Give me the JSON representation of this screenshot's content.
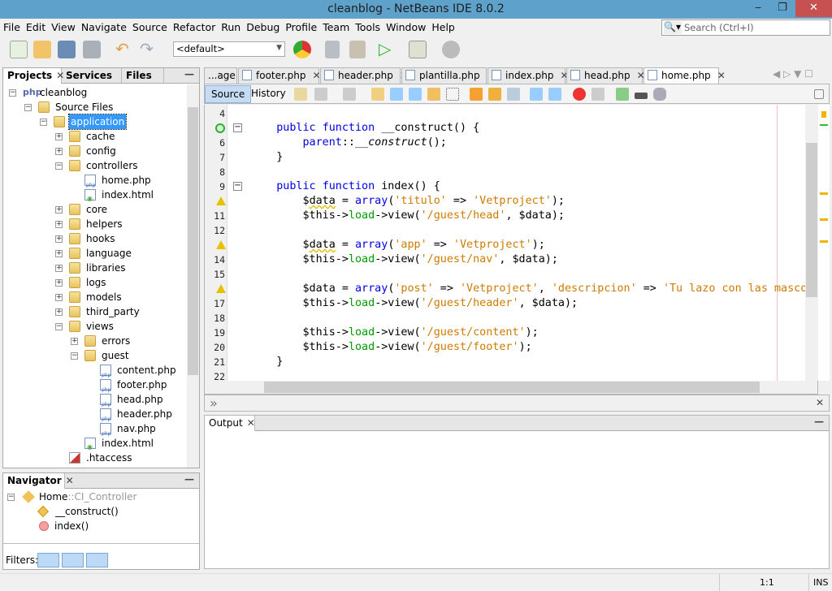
{
  "window": {
    "title": "cleanblog - NetBeans IDE 8.0.2",
    "minimize": "‒",
    "restore": "❐",
    "close": "✕"
  },
  "menu": [
    "File",
    "Edit",
    "View",
    "Navigate",
    "Source",
    "Refactor",
    "Run",
    "Debug",
    "Profile",
    "Team",
    "Tools",
    "Window",
    "Help"
  ],
  "search": {
    "placeholder": "Search (Ctrl+I)"
  },
  "toolbar": {
    "config": "<default>",
    "icons": [
      "new-file-icon",
      "new-project-icon",
      "open-project-icon",
      "save-all-icon",
      "undo-icon",
      "redo-icon",
      "browser-chrome-icon",
      "build-icon",
      "clean-build-icon",
      "run-icon",
      "debug-icon",
      "profile-icon"
    ]
  },
  "projects": {
    "tabs": [
      {
        "label": "Projects",
        "close": "✕"
      },
      {
        "label": "Services"
      },
      {
        "label": "Files"
      }
    ],
    "minimize": "—",
    "tree": [
      {
        "label": "cleanblog",
        "d": 0,
        "exp": "-",
        "icon": "php"
      },
      {
        "label": "Source Files",
        "d": 1,
        "exp": "-",
        "icon": "folder"
      },
      {
        "label": "application",
        "d": 2,
        "exp": "-",
        "icon": "folder",
        "selected": true
      },
      {
        "label": "cache",
        "d": 3,
        "exp": "+",
        "icon": "folder"
      },
      {
        "label": "config",
        "d": 3,
        "exp": "+",
        "icon": "folder"
      },
      {
        "label": "controllers",
        "d": 3,
        "exp": "-",
        "icon": "folder"
      },
      {
        "label": "home.php",
        "d": 4,
        "icon": "file"
      },
      {
        "label": "index.html",
        "d": 4,
        "icon": "html"
      },
      {
        "label": "core",
        "d": 3,
        "exp": "+",
        "icon": "folder"
      },
      {
        "label": "helpers",
        "d": 3,
        "exp": "+",
        "icon": "folder"
      },
      {
        "label": "hooks",
        "d": 3,
        "exp": "+",
        "icon": "folder"
      },
      {
        "label": "language",
        "d": 3,
        "exp": "+",
        "icon": "folder"
      },
      {
        "label": "libraries",
        "d": 3,
        "exp": "+",
        "icon": "folder"
      },
      {
        "label": "logs",
        "d": 3,
        "exp": "+",
        "icon": "folder"
      },
      {
        "label": "models",
        "d": 3,
        "exp": "+",
        "icon": "folder"
      },
      {
        "label": "third_party",
        "d": 3,
        "exp": "+",
        "icon": "folder"
      },
      {
        "label": "views",
        "d": 3,
        "exp": "-",
        "icon": "folder"
      },
      {
        "label": "errors",
        "d": 4,
        "exp": "+",
        "icon": "folder"
      },
      {
        "label": "guest",
        "d": 4,
        "exp": "-",
        "icon": "folder"
      },
      {
        "label": "content.php",
        "d": 5,
        "icon": "file"
      },
      {
        "label": "footer.php",
        "d": 5,
        "icon": "file"
      },
      {
        "label": "head.php",
        "d": 5,
        "icon": "file"
      },
      {
        "label": "header.php",
        "d": 5,
        "icon": "file"
      },
      {
        "label": "nav.php",
        "d": 5,
        "icon": "file"
      },
      {
        "label": "index.html",
        "d": 4,
        "icon": "html"
      },
      {
        "label": ".htaccess",
        "d": 3,
        "icon": "htaccess"
      }
    ]
  },
  "navigator": {
    "title": "Navigator",
    "close": "✕",
    "minimize": "—",
    "root": "Home",
    "root_parent": "::CI_Controller",
    "items": [
      "__construct()",
      "index()"
    ],
    "filters_label": "Filters:"
  },
  "editor": {
    "tabs": [
      {
        "label": "...age"
      },
      {
        "label": "footer.php",
        "close": "✕"
      },
      {
        "label": "header.php",
        "close": "✕"
      },
      {
        "label": "plantilla.php",
        "close": "✕"
      },
      {
        "label": "index.php",
        "close": "✕"
      },
      {
        "label": "head.php",
        "close": "✕"
      },
      {
        "label": "home.php",
        "close": "✕",
        "active": true
      }
    ],
    "source_label": "Source",
    "history_label": "History",
    "lines": [
      {
        "n": "4",
        "t": []
      },
      {
        "n": "5",
        "mark": "override",
        "fold": "-",
        "t": [
          [
            "",
            "    "
          ],
          [
            "kw",
            "public"
          ],
          [
            "",
            " "
          ],
          [
            "kw",
            "function"
          ],
          [
            "",
            " __construct() {"
          ]
        ]
      },
      {
        "n": "6",
        "t": [
          [
            "",
            "        "
          ],
          [
            "kw",
            "parent"
          ],
          [
            "",
            "::"
          ],
          [
            "it",
            "__construct"
          ],
          [
            "",
            "();"
          ]
        ]
      },
      {
        "n": "7",
        "t": [
          [
            "",
            "    }"
          ]
        ]
      },
      {
        "n": "8",
        "t": []
      },
      {
        "n": "9",
        "fold": "-",
        "t": [
          [
            "",
            "    "
          ],
          [
            "kw",
            "public"
          ],
          [
            "",
            " "
          ],
          [
            "kw",
            "function"
          ],
          [
            "",
            " index() {"
          ]
        ]
      },
      {
        "n": "10",
        "mark": "warning",
        "t": [
          [
            "",
            "        $"
          ],
          [
            "wv",
            "data"
          ],
          [
            "",
            " = "
          ],
          [
            "kw",
            "array"
          ],
          [
            "",
            "("
          ],
          [
            "str",
            "'titulo'"
          ],
          [
            "",
            " => "
          ],
          [
            "str",
            "'Vetproject'"
          ],
          [
            "",
            ");"
          ]
        ]
      },
      {
        "n": "11",
        "t": [
          [
            "",
            "        $this->"
          ],
          [
            "fld",
            "load"
          ],
          [
            "",
            "->view("
          ],
          [
            "str",
            "'/guest/head'"
          ],
          [
            "",
            ", $data);"
          ]
        ]
      },
      {
        "n": "12",
        "t": []
      },
      {
        "n": "13",
        "mark": "warning",
        "t": [
          [
            "",
            "        $"
          ],
          [
            "wv",
            "data"
          ],
          [
            "",
            " = "
          ],
          [
            "kw",
            "array"
          ],
          [
            "",
            "("
          ],
          [
            "str",
            "'app'"
          ],
          [
            "",
            " => "
          ],
          [
            "str",
            "'Vetproject'"
          ],
          [
            "",
            ");"
          ]
        ]
      },
      {
        "n": "14",
        "t": [
          [
            "",
            "        $this->"
          ],
          [
            "fld",
            "load"
          ],
          [
            "",
            "->view("
          ],
          [
            "str",
            "'/guest/nav'"
          ],
          [
            "",
            ", $data);"
          ]
        ]
      },
      {
        "n": "15",
        "t": []
      },
      {
        "n": "16",
        "mark": "warning",
        "t": [
          [
            "",
            "        $data = "
          ],
          [
            "kw",
            "array"
          ],
          [
            "",
            "("
          ],
          [
            "str",
            "'post'"
          ],
          [
            "",
            " => "
          ],
          [
            "str",
            "'Vetproject'"
          ],
          [
            "",
            ", "
          ],
          [
            "str",
            "'descripcion'"
          ],
          [
            "",
            " => "
          ],
          [
            "str",
            "'Tu lazo con las mascotas'"
          ]
        ]
      },
      {
        "n": "17",
        "t": [
          [
            "",
            "        $this->"
          ],
          [
            "fld",
            "load"
          ],
          [
            "",
            "->view("
          ],
          [
            "str",
            "'/guest/header'"
          ],
          [
            "",
            ", $data);"
          ]
        ]
      },
      {
        "n": "18",
        "t": []
      },
      {
        "n": "19",
        "t": [
          [
            "",
            "        $this->"
          ],
          [
            "fld",
            "load"
          ],
          [
            "",
            "->view("
          ],
          [
            "str",
            "'/guest/content'"
          ],
          [
            "",
            ");"
          ]
        ]
      },
      {
        "n": "20",
        "t": [
          [
            "",
            "        $this->"
          ],
          [
            "fld",
            "load"
          ],
          [
            "",
            "->view("
          ],
          [
            "str",
            "'/guest/footer'"
          ],
          [
            "",
            ");"
          ]
        ]
      },
      {
        "n": "21",
        "t": [
          [
            "",
            "    }"
          ]
        ]
      },
      {
        "n": "22",
        "t": []
      }
    ]
  },
  "breadcrumb": {
    "icon": "»",
    "close": "✕"
  },
  "output": {
    "title": "Output",
    "close": "✕",
    "minimize": "—"
  },
  "status": {
    "position": "1:1",
    "mode": "INS"
  }
}
